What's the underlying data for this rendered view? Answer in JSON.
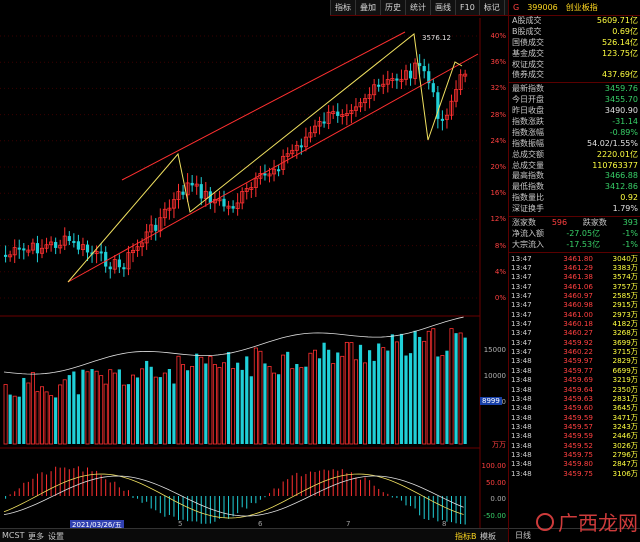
{
  "toolbar": {
    "buttons": [
      "指标",
      "叠加",
      "历史",
      "统计",
      "画线",
      "F10",
      "标记",
      "-自选",
      "返回"
    ]
  },
  "chart": {
    "peak_label": "3576.12",
    "pct_axis": [
      "40%",
      "36%",
      "32%",
      "28%",
      "24%",
      "20%",
      "16%",
      "12%",
      "8%",
      "4%",
      "0%"
    ],
    "vol_axis": [
      "15000",
      "10000",
      "5000"
    ],
    "vol_unit": "万万",
    "vol_current": "8999",
    "macd_axis": [
      "100.00",
      "50.00",
      "0.00",
      "-50.00"
    ],
    "dates": [
      "2021/03/26/五",
      "5",
      "6",
      "7",
      "8"
    ],
    "bottom_left": [
      "MCST",
      "更多",
      "设置"
    ],
    "bottom_right": [
      "指标B",
      "模板"
    ],
    "colors": {
      "up": "#ff3030",
      "down": "#20d0d8",
      "yellow": "#f0e060",
      "white": "#e0e0e0",
      "magenta": "#ff40ff"
    }
  },
  "chart_data": {
    "type": "candlestick",
    "series": [
      {
        "name": "K",
        "note": "daily candles (approximate shape)"
      }
    ]
  },
  "side": {
    "group_no": "G",
    "code": "399006",
    "name": "创业板指",
    "stats": [
      {
        "k": "A股成交",
        "v": "5609.71亿",
        "c": "yellow"
      },
      {
        "k": "B股成交",
        "v": "0.69亿",
        "c": "yellow"
      },
      {
        "k": "国债成交",
        "v": "526.14亿",
        "c": "yellow"
      },
      {
        "k": "基金成交",
        "v": "123.75亿",
        "c": "yellow"
      },
      {
        "k": "权证成交",
        "v": "",
        "c": "yellow"
      },
      {
        "k": "债券成交",
        "v": "437.69亿",
        "c": "yellow"
      }
    ],
    "quote": [
      {
        "k": "最新指数",
        "v": "3459.76",
        "c": "green"
      },
      {
        "k": "今日开盘",
        "v": "3455.70",
        "c": "green"
      },
      {
        "k": "昨日收盘",
        "v": "3490.90",
        "c": "white"
      },
      {
        "k": "指数涨跌",
        "v": "-31.14",
        "c": "green"
      },
      {
        "k": "指数涨幅",
        "v": "-0.89%",
        "c": "green"
      },
      {
        "k": "指数振幅",
        "v": "54.02/1.55%",
        "c": "white"
      },
      {
        "k": "总成交额",
        "v": "2220.01亿",
        "c": "yellow"
      },
      {
        "k": "总成交量",
        "v": "110763377",
        "c": "yellow"
      },
      {
        "k": "最高指数",
        "v": "3466.88",
        "c": "green"
      },
      {
        "k": "最低指数",
        "v": "3412.86",
        "c": "green"
      },
      {
        "k": "指数量比",
        "v": "0.92",
        "c": "yellow"
      },
      {
        "k": "深证换手",
        "v": "1.79%",
        "c": "white"
      }
    ],
    "updown": {
      "up_label": "涨家数",
      "up": "596",
      "down_label": "跌家数",
      "down": "393"
    },
    "flows": [
      {
        "k": "净流入额",
        "v1": "-27.05亿",
        "v2": "-1%"
      },
      {
        "k": "大宗流入",
        "v1": "-17.53亿",
        "v2": "-1%"
      }
    ],
    "ticks": [
      {
        "t": "13:47",
        "p": "3461.80",
        "d": "up",
        "v": "3040万"
      },
      {
        "t": "13:47",
        "p": "3461.29",
        "d": "up",
        "v": "3383万"
      },
      {
        "t": "13:47",
        "p": "3461.38",
        "d": "up",
        "v": "3574万"
      },
      {
        "t": "13:47",
        "p": "3461.06",
        "d": "up",
        "v": "3757万"
      },
      {
        "t": "13:47",
        "p": "3460.97",
        "d": "up",
        "v": "2585万"
      },
      {
        "t": "13:47",
        "p": "3460.98",
        "d": "up",
        "v": "2915万"
      },
      {
        "t": "13:47",
        "p": "3461.00",
        "d": "up",
        "v": "2973万"
      },
      {
        "t": "13:47",
        "p": "3460.18",
        "d": "up",
        "v": "4182万"
      },
      {
        "t": "13:47",
        "p": "3460.27",
        "d": "up",
        "v": "3268万"
      },
      {
        "t": "13:47",
        "p": "3459.92",
        "d": "up",
        "v": "3699万"
      },
      {
        "t": "13:47",
        "p": "3460.22",
        "d": "up",
        "v": "3715万"
      },
      {
        "t": "13:48",
        "p": "3459.97",
        "d": "up",
        "v": "2829万"
      },
      {
        "t": "13:48",
        "p": "3459.77",
        "d": "up",
        "v": "6699万"
      },
      {
        "t": "13:48",
        "p": "3459.69",
        "d": "up",
        "v": "3219万"
      },
      {
        "t": "13:48",
        "p": "3459.64",
        "d": "up",
        "v": "2350万"
      },
      {
        "t": "13:48",
        "p": "3459.63",
        "d": "up",
        "v": "2831万"
      },
      {
        "t": "13:48",
        "p": "3459.60",
        "d": "up",
        "v": "3645万"
      },
      {
        "t": "13:48",
        "p": "3459.59",
        "d": "up",
        "v": "3471万"
      },
      {
        "t": "13:48",
        "p": "3459.57",
        "d": "up",
        "v": "3243万"
      },
      {
        "t": "13:48",
        "p": "3459.59",
        "d": "up",
        "v": "2446万"
      },
      {
        "t": "13:48",
        "p": "3459.52",
        "d": "up",
        "v": "3026万"
      },
      {
        "t": "13:48",
        "p": "3459.75",
        "d": "up",
        "v": "2796万"
      },
      {
        "t": "13:48",
        "p": "3459.80",
        "d": "up",
        "v": "2847万"
      },
      {
        "t": "13:48",
        "p": "3459.75",
        "d": "up",
        "v": "3106万"
      }
    ],
    "footer": [
      "日线",
      "日线"
    ],
    "watermark": "广西龙网"
  }
}
